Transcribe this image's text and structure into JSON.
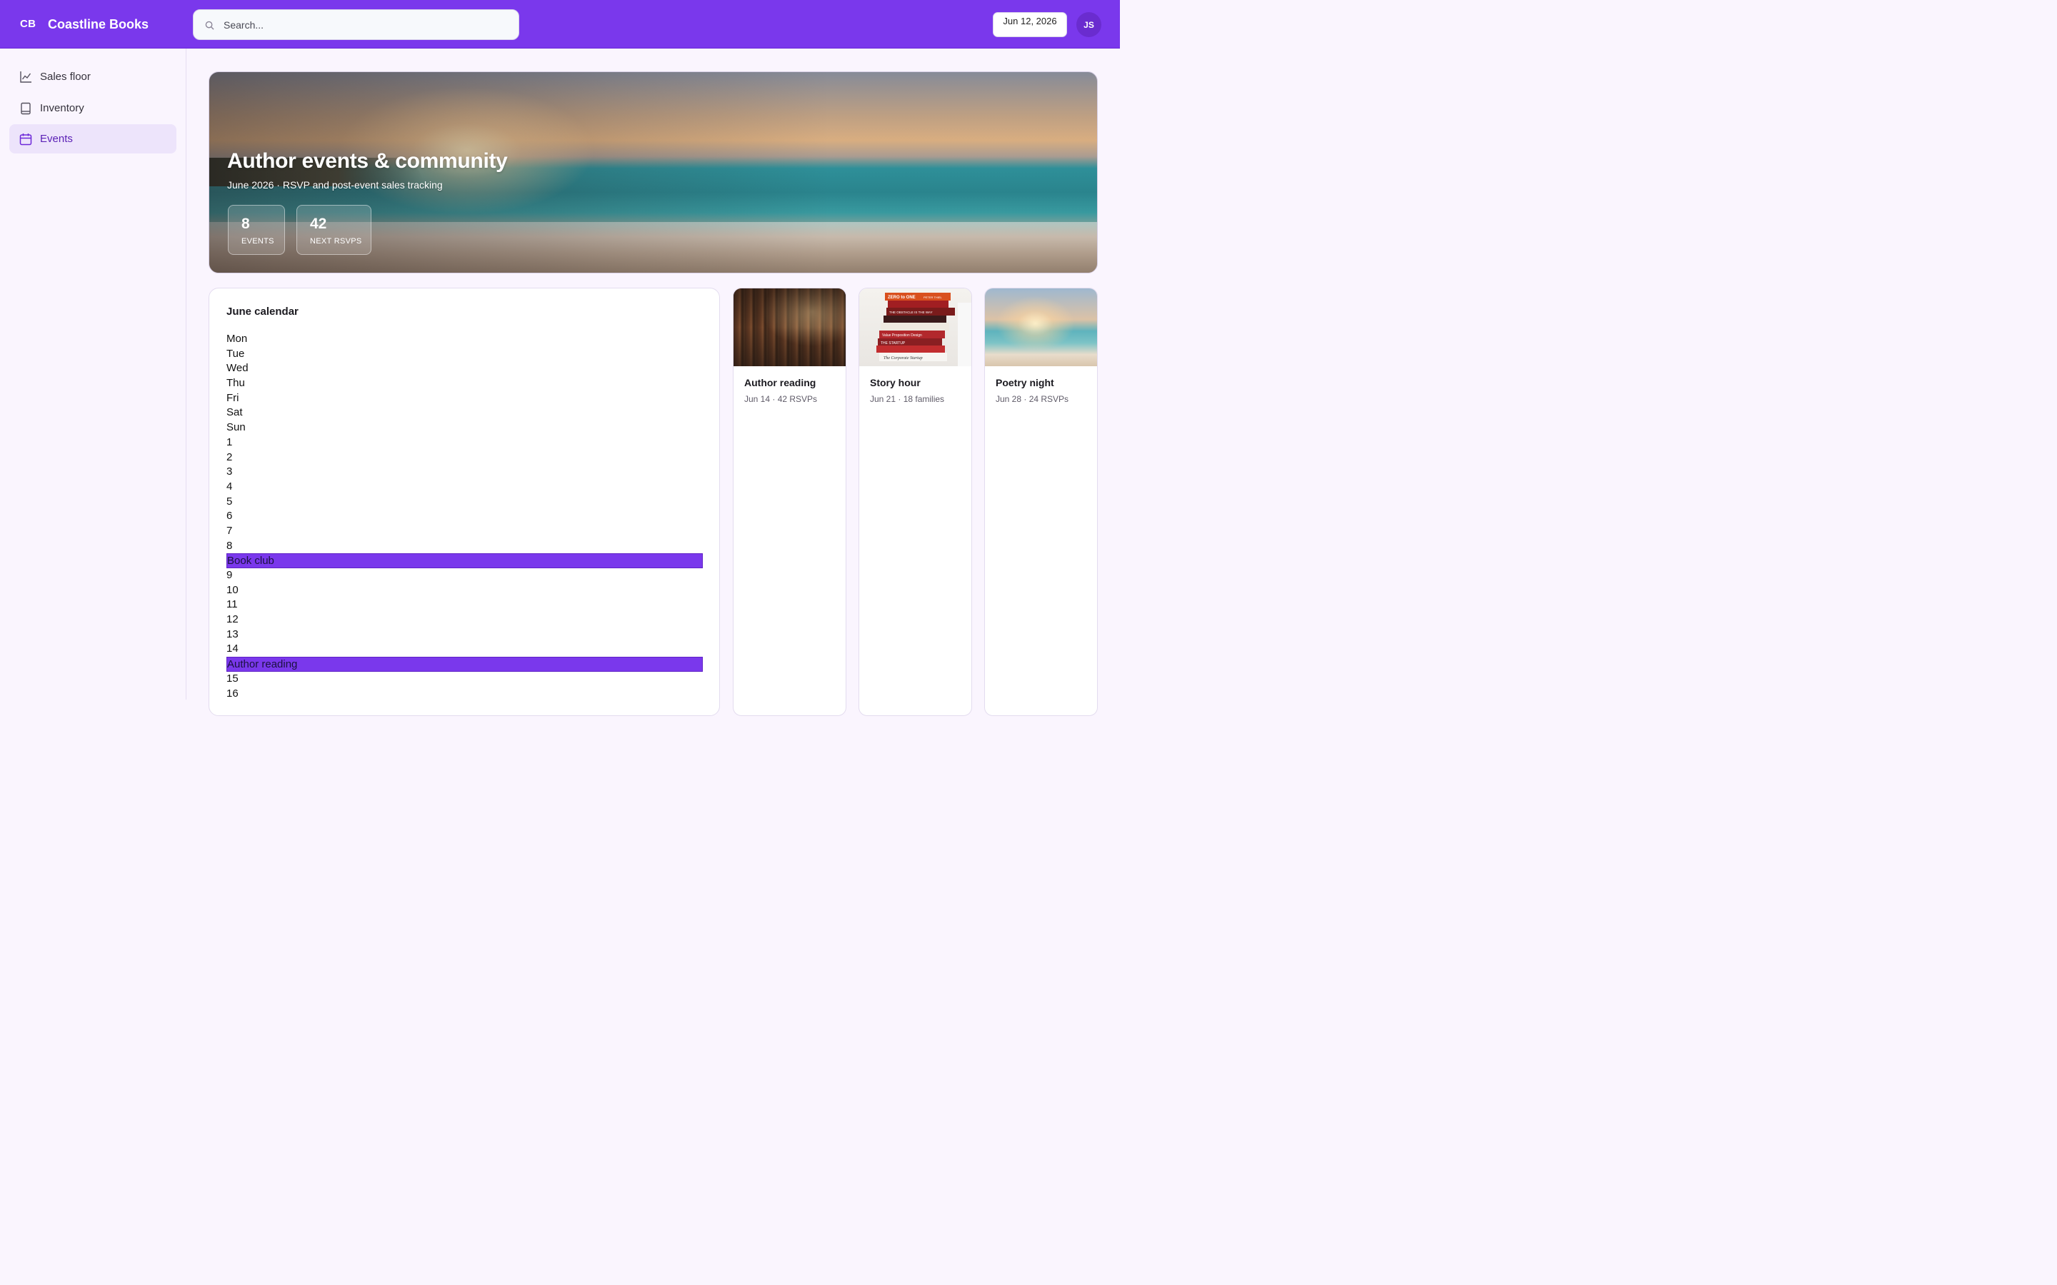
{
  "brand": {
    "mark": "CB",
    "name": "Coastline Books"
  },
  "search": {
    "placeholder": "Search..."
  },
  "header": {
    "date": "Jun 12, 2026",
    "avatar_initials": "JS"
  },
  "sidebar": {
    "items": [
      {
        "label": "Sales floor",
        "icon": "chart-line-icon",
        "active": false
      },
      {
        "label": "Inventory",
        "icon": "book-icon",
        "active": false
      },
      {
        "label": "Events",
        "icon": "calendar-icon",
        "active": true
      }
    ]
  },
  "hero": {
    "title": "Author events & community",
    "subtitle": "June 2026 · RSVP and post-event sales tracking",
    "stats": [
      {
        "value": "8",
        "label": "EVENTS"
      },
      {
        "value": "42",
        "label": "NEXT RSVPS"
      }
    ]
  },
  "calendar": {
    "title": "June calendar",
    "rows": [
      {
        "text": "Mon",
        "event": false
      },
      {
        "text": "Tue",
        "event": false
      },
      {
        "text": "Wed",
        "event": false
      },
      {
        "text": "Thu",
        "event": false
      },
      {
        "text": "Fri",
        "event": false
      },
      {
        "text": "Sat",
        "event": false
      },
      {
        "text": "Sun",
        "event": false
      },
      {
        "text": "1",
        "event": false
      },
      {
        "text": "2",
        "event": false
      },
      {
        "text": "3",
        "event": false
      },
      {
        "text": "4",
        "event": false
      },
      {
        "text": "5",
        "event": false
      },
      {
        "text": "6",
        "event": false
      },
      {
        "text": "7",
        "event": false
      },
      {
        "text": "8",
        "event": false
      },
      {
        "text": "Book club",
        "event": true
      },
      {
        "text": "9",
        "event": false
      },
      {
        "text": "10",
        "event": false
      },
      {
        "text": "11",
        "event": false
      },
      {
        "text": "12",
        "event": false
      },
      {
        "text": "13",
        "event": false
      },
      {
        "text": "14",
        "event": false
      },
      {
        "text": "Author reading",
        "event": true
      },
      {
        "text": "15",
        "event": false
      },
      {
        "text": "16",
        "event": false
      }
    ]
  },
  "events": [
    {
      "name": "Author reading",
      "meta": "Jun 14 · 42 RSVPs",
      "image": "library-shelves"
    },
    {
      "name": "Story hour",
      "meta": "Jun 21 · 18 families",
      "image": "book-stack"
    },
    {
      "name": "Poetry night",
      "meta": "Jun 28 · 24 RSVPs",
      "image": "beach-sunset"
    }
  ],
  "book_stack_spines": [
    "ZERO to ONE",
    "PETER THIEL",
    "THE OBSTACLE IS THE WAY",
    "Value Proposition Design",
    "THE STARTUP",
    "The Corporate Startup"
  ],
  "colors": {
    "accent": "#7a38ec",
    "active_nav_bg": "#ede4fb",
    "event_bar": "#7a38ec"
  }
}
